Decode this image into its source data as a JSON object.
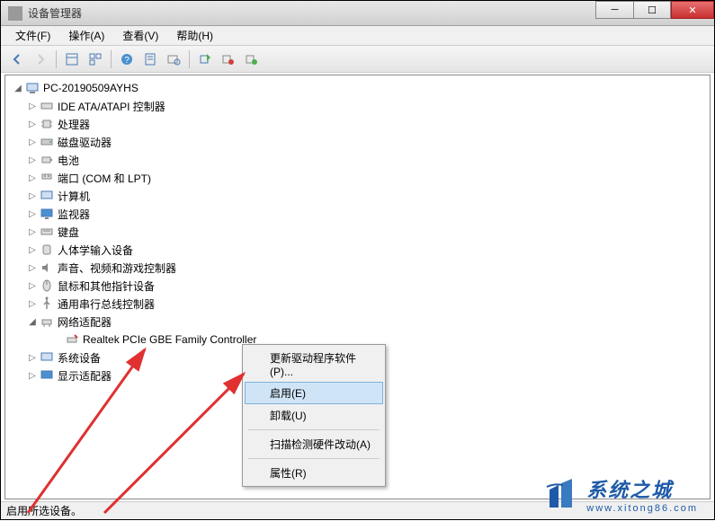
{
  "window": {
    "title": "设备管理器"
  },
  "menu": {
    "file": "文件(F)",
    "action": "操作(A)",
    "view": "查看(V)",
    "help": "帮助(H)"
  },
  "tree": {
    "root": "PC-20190509AYHS",
    "items": [
      {
        "label": "IDE ATA/ATAPI 控制器"
      },
      {
        "label": "处理器"
      },
      {
        "label": "磁盘驱动器"
      },
      {
        "label": "电池"
      },
      {
        "label": "端口 (COM 和 LPT)"
      },
      {
        "label": "计算机"
      },
      {
        "label": "监视器"
      },
      {
        "label": "键盘"
      },
      {
        "label": "人体学输入设备"
      },
      {
        "label": "声音、视频和游戏控制器"
      },
      {
        "label": "鼠标和其他指针设备"
      },
      {
        "label": "通用串行总线控制器"
      },
      {
        "label": "网络适配器",
        "expanded": true,
        "children": [
          {
            "label": "Realtek PCIe GBE Family Controller"
          }
        ]
      },
      {
        "label": "系统设备"
      },
      {
        "label": "显示适配器"
      }
    ]
  },
  "context_menu": {
    "update_driver": "更新驱动程序软件(P)...",
    "enable": "启用(E)",
    "uninstall": "卸载(U)",
    "scan_hardware": "扫描检测硬件改动(A)",
    "properties": "属性(R)"
  },
  "statusbar": {
    "text": "启用所选设备。"
  },
  "watermark": {
    "title": "系统之城",
    "url": "www.xitong86.com"
  }
}
